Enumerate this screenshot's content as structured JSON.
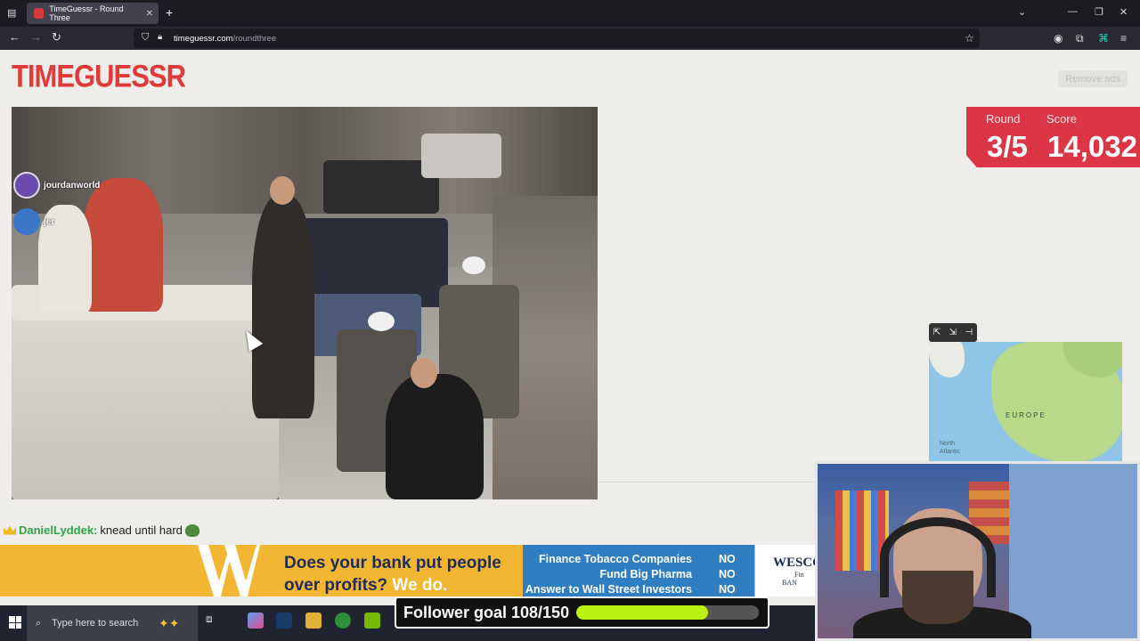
{
  "browser": {
    "tab_title": "TimeGuessr - Round Three",
    "url_domain": "timeguessr.com",
    "url_path": "/roundthree"
  },
  "page": {
    "logo_text": "TIMEGUESSR",
    "remove_ads_label": "Remove ads",
    "round_label": "Round",
    "round_value": "3/5",
    "score_label": "Score",
    "score_value": "14,032",
    "viewers": [
      "jourdanworld",
      "jer"
    ],
    "map_label_europe": "EUROPE",
    "map_label_atlantic": "North Atlantic"
  },
  "chat": {
    "username": "DanielLyddek:",
    "message": "knead until hard"
  },
  "ad": {
    "headline_line1": "Does your bank put people",
    "headline_line2": "over profits?",
    "headline_highlight": "We do.",
    "rows": [
      {
        "label": "Finance Tobacco Companies",
        "value": "NO"
      },
      {
        "label": "Fund Big Pharma",
        "value": "NO"
      },
      {
        "label": "Answer to Wall Street Investors",
        "value": "NO"
      }
    ],
    "brand": "WESCO",
    "brand_sub": "Fin",
    "brand_sub2": "BAN"
  },
  "taskbar": {
    "search_placeholder": "Type here to search"
  },
  "stream": {
    "follower_goal_text": "Follower goal 108/150",
    "follower_progress": 0.72
  },
  "colors": {
    "brand_red": "#df3b3b",
    "score_red": "#dc3545",
    "goal_green": "#b9f211",
    "ad_yellow": "#f2b632",
    "ad_blue": "#2f7ec1"
  }
}
